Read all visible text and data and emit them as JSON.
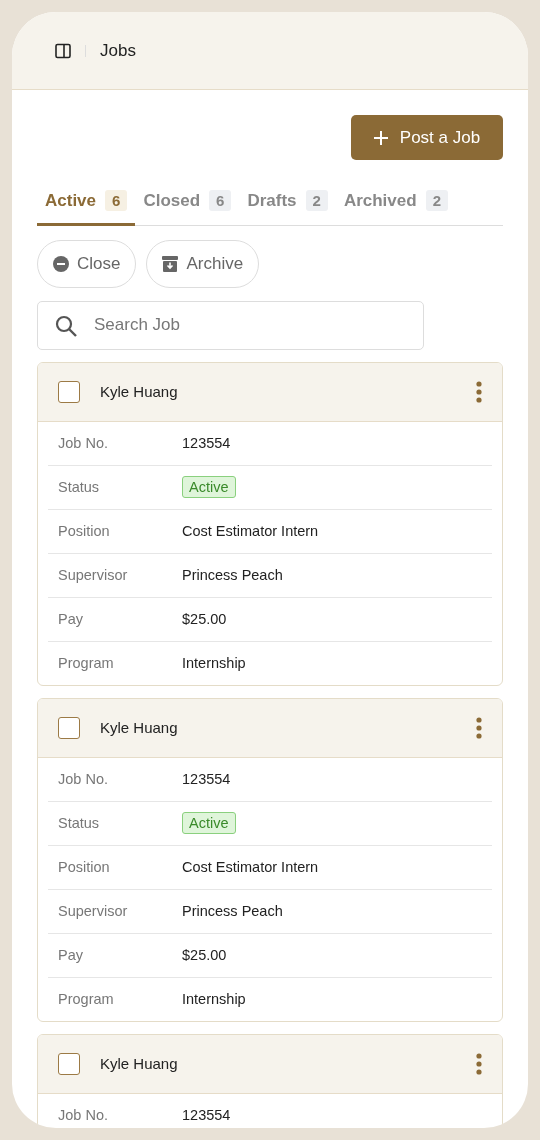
{
  "header": {
    "title": "Jobs"
  },
  "post_button": {
    "label": "Post a Job"
  },
  "tabs": [
    {
      "label": "Active",
      "count": "6",
      "selected": true
    },
    {
      "label": "Closed",
      "count": "6",
      "selected": false
    },
    {
      "label": "Drafts",
      "count": "2",
      "selected": false
    },
    {
      "label": "Archived",
      "count": "2",
      "selected": false
    }
  ],
  "actions": [
    {
      "kind": "close",
      "label": "Close"
    },
    {
      "kind": "archive",
      "label": "Archive"
    }
  ],
  "search": {
    "placeholder": "Search Job"
  },
  "jobs": [
    {
      "name": "Kyle Huang",
      "checked": false,
      "rows": [
        {
          "label": "Job No.",
          "value": "123554",
          "kind": "text"
        },
        {
          "label": "Status",
          "value": "Active",
          "kind": "badge"
        },
        {
          "label": "Position",
          "value": "Cost Estimator Intern",
          "kind": "text"
        },
        {
          "label": "Supervisor",
          "value": "Princess Peach",
          "kind": "text"
        },
        {
          "label": "Pay",
          "value": "$25.00",
          "kind": "text"
        },
        {
          "label": "Program",
          "value": "Internship",
          "kind": "text"
        }
      ]
    },
    {
      "name": "Kyle Huang",
      "checked": false,
      "rows": [
        {
          "label": "Job No.",
          "value": "123554",
          "kind": "text"
        },
        {
          "label": "Status",
          "value": "Active",
          "kind": "badge"
        },
        {
          "label": "Position",
          "value": "Cost Estimator Intern",
          "kind": "text"
        },
        {
          "label": "Supervisor",
          "value": "Princess Peach",
          "kind": "text"
        },
        {
          "label": "Pay",
          "value": "$25.00",
          "kind": "text"
        },
        {
          "label": "Program",
          "value": "Internship",
          "kind": "text"
        }
      ]
    },
    {
      "name": "Kyle Huang",
      "checked": false,
      "rows": [
        {
          "label": "Job No.",
          "value": "123554",
          "kind": "text"
        }
      ]
    }
  ]
}
